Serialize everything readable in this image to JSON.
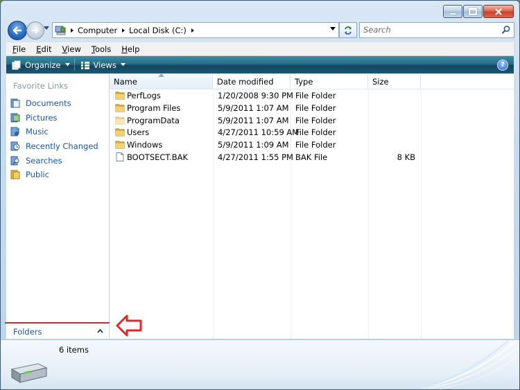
{
  "address": {
    "crumbs": [
      "Computer",
      "Local Disk (C:)"
    ]
  },
  "search": {
    "placeholder": "Search"
  },
  "menu": [
    {
      "key": "F",
      "rest": "ile"
    },
    {
      "key": "E",
      "rest": "dit"
    },
    {
      "key": "V",
      "rest": "iew"
    },
    {
      "key": "T",
      "rest": "ools"
    },
    {
      "key": "H",
      "rest": "elp"
    }
  ],
  "toolbar": {
    "organize": "Organize",
    "views": "Views"
  },
  "nav_pane": {
    "favorites_title": "Favorite Links",
    "links": [
      "Documents",
      "Pictures",
      "Music",
      "Recently Changed",
      "Searches",
      "Public"
    ],
    "folders_label": "Folders"
  },
  "columns": {
    "name": "Name",
    "date": "Date modified",
    "type": "Type",
    "size": "Size"
  },
  "files": [
    {
      "name": "PerfLogs",
      "date": "1/20/2008 9:30 PM",
      "type": "File Folder",
      "size": "",
      "icon": "folder-icon"
    },
    {
      "name": "Program Files",
      "date": "5/9/2011 1:07 AM",
      "type": "File Folder",
      "size": "",
      "icon": "folder-icon"
    },
    {
      "name": "ProgramData",
      "date": "5/9/2011 1:07 AM",
      "type": "File Folder",
      "size": "",
      "icon": "folder-icon"
    },
    {
      "name": "Users",
      "date": "4/27/2011 10:59 AM",
      "type": "File Folder",
      "size": "",
      "icon": "folder-icon"
    },
    {
      "name": "Windows",
      "date": "5/9/2011 1:09 AM",
      "type": "File Folder",
      "size": "",
      "icon": "folder-icon"
    },
    {
      "name": "BOOTSECT.BAK",
      "date": "4/27/2011 1:55 PM",
      "type": "BAK File",
      "size": "8 KB",
      "icon": "file-icon"
    }
  ],
  "details": {
    "count": "6 items"
  },
  "colors": {
    "link": "#1e57a4",
    "command_bar": "#2a6b88",
    "annotation": "#d82a2a"
  }
}
